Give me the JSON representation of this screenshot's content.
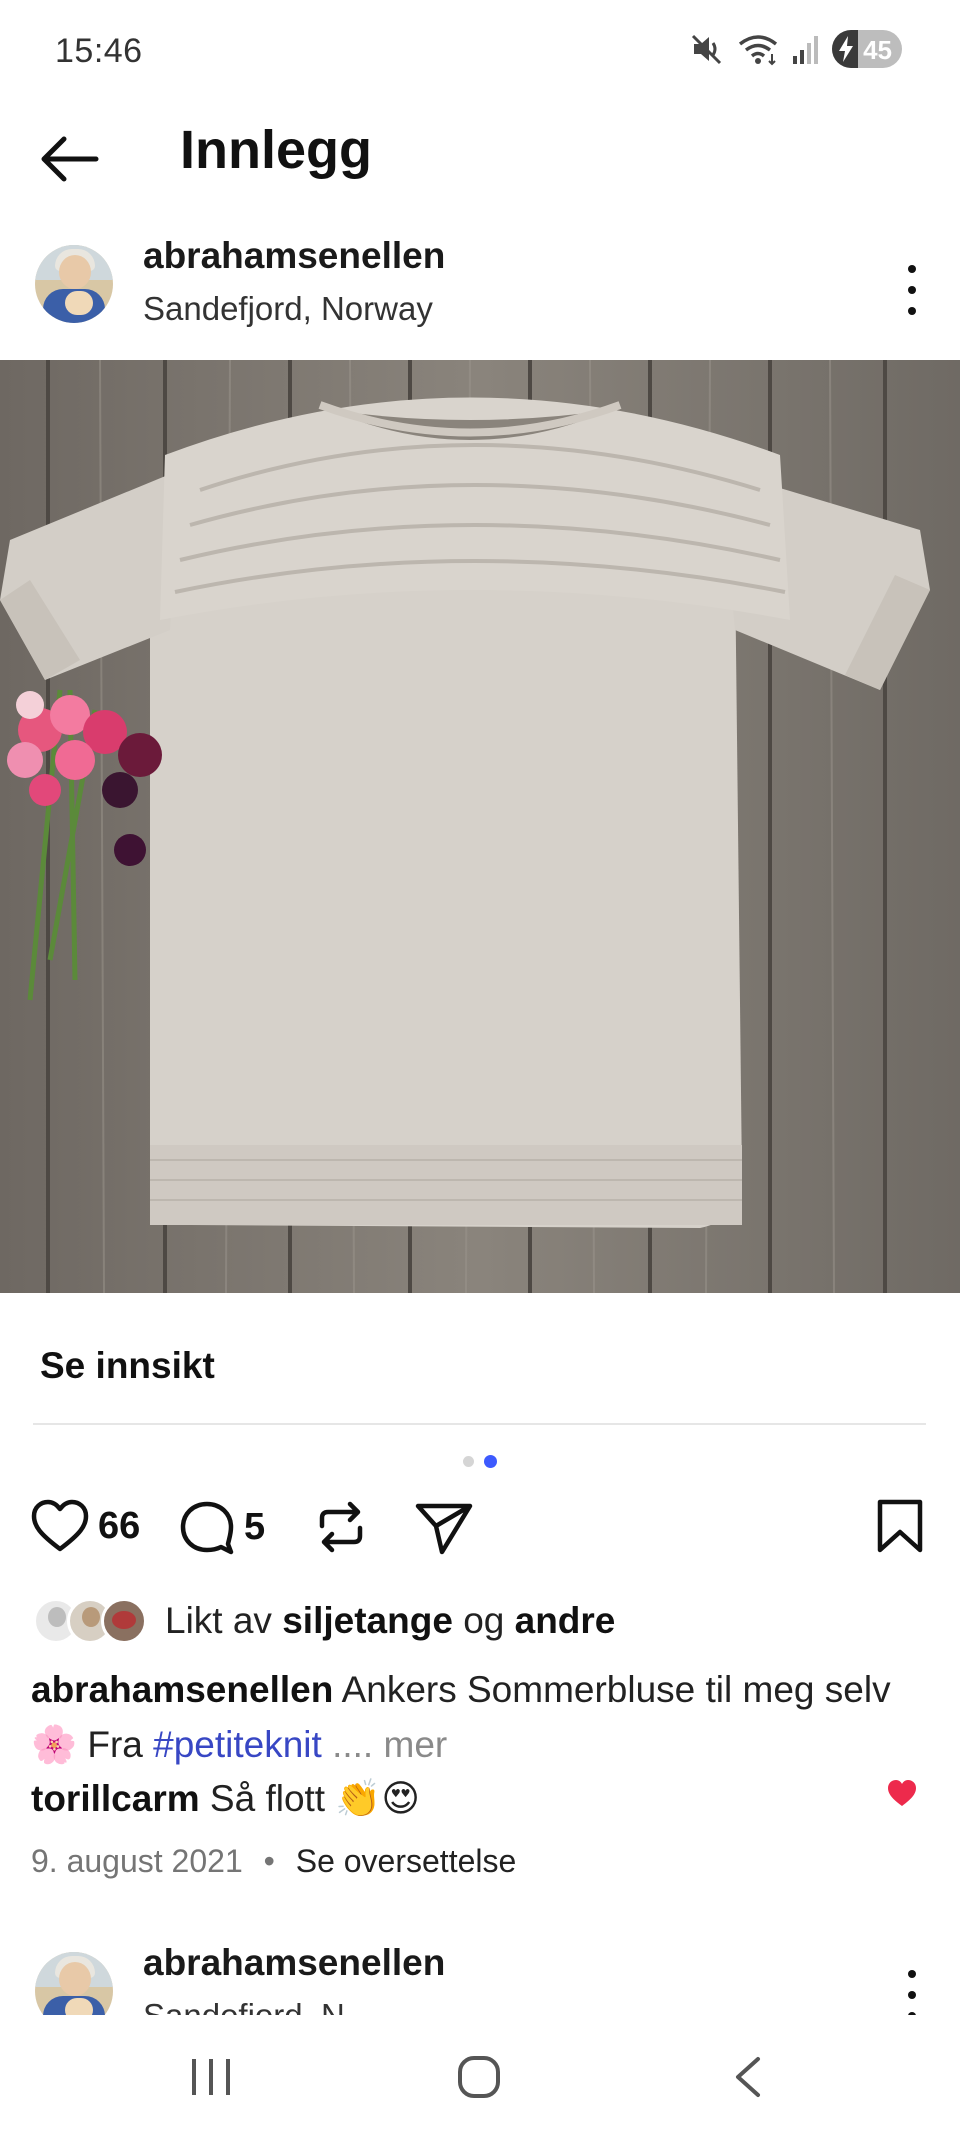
{
  "status_bar": {
    "time": "15:46",
    "battery": "45",
    "icons": [
      "mute-icon",
      "wifi-icon",
      "signal-icon",
      "battery-icon"
    ]
  },
  "top_bar": {
    "title": "Innlegg",
    "back_icon": "arrow-left-icon"
  },
  "post": {
    "username": "abrahamsenellen",
    "location": "Sandefjord, Norway",
    "more_icon": "more-vertical-icon",
    "image_description_icon": "photo-knitted-sweater",
    "insights_label": "Se innsikt",
    "carousel": {
      "count": 2,
      "active_index": 1
    },
    "actions": {
      "likes_count": "66",
      "comments_count": "5"
    },
    "liked_by": {
      "prefix": "Likt av",
      "user": "siljetange",
      "conjunction": "og",
      "others": "andre"
    },
    "caption": {
      "username": "abrahamsenellen",
      "text": "Ankers Sommerbluse til meg selv 🌸 Fra",
      "hashtag": "#petiteknit",
      "ellipsis": "....",
      "more": "mer"
    },
    "comment": {
      "username": "torillcarm",
      "text": "Så flott 👏😍"
    },
    "date": "9. august 2021",
    "separator": "•",
    "translate": "Se oversettelse"
  },
  "next_post": {
    "username": "abrahamsenellen",
    "location_partial": "Sandefjord, N"
  },
  "colors": {
    "hashtag": "#3847c4",
    "carousel_active": "#3d5afe",
    "heart_liked": "#ed2a4c"
  }
}
